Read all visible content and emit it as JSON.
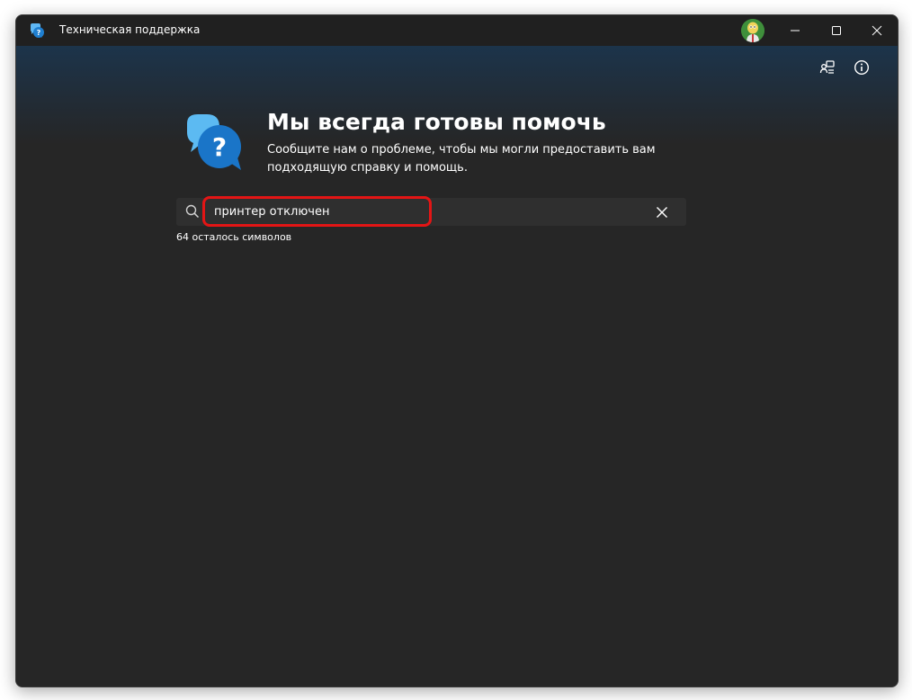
{
  "window": {
    "title": "Техническая поддержка"
  },
  "header": {
    "title": "Мы всегда готовы помочь",
    "description": "Сообщите нам о проблеме, чтобы мы могли предоставить вам подходящую справку и помощь."
  },
  "search": {
    "value": "принтер отключен",
    "placeholder": "",
    "chars_left_label": "64 осталось символов"
  },
  "icons": {
    "app": "get-help-icon",
    "search": "search-icon",
    "clear": "close-icon",
    "connect": "connect-devices-icon",
    "info": "info-icon",
    "avatar": "user-avatar"
  },
  "colors": {
    "accent_blue": "#1f8fe0",
    "highlight_red": "#e31515",
    "background": "#262626",
    "header_gradient_top": "#1c344b"
  }
}
